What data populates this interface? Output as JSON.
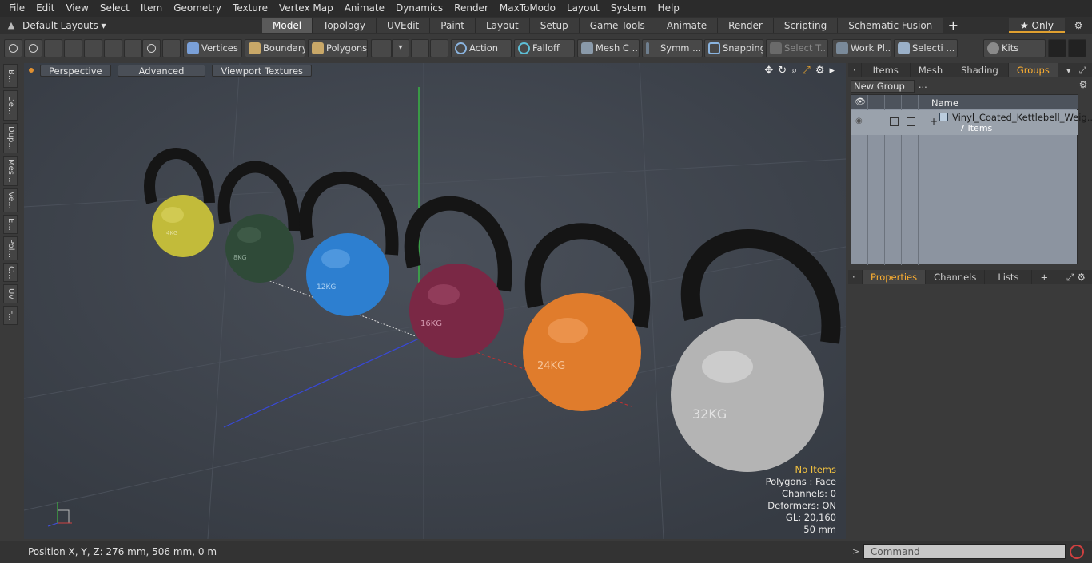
{
  "menu": [
    "File",
    "Edit",
    "View",
    "Select",
    "Item",
    "Geometry",
    "Texture",
    "Vertex Map",
    "Animate",
    "Dynamics",
    "Render",
    "MaxToModo",
    "Layout",
    "System",
    "Help"
  ],
  "layout": {
    "current": "Default Layouts ▾",
    "tabs": [
      "Model",
      "Topology",
      "UVEdit",
      "Paint",
      "Layout",
      "Setup",
      "Game Tools",
      "Animate",
      "Render",
      "Scripting",
      "Schematic Fusion"
    ],
    "active_tab": "Model",
    "only_label": "★ Only"
  },
  "toolbar": {
    "vertices": "Vertices",
    "boundary": "Boundary",
    "polygons": "Polygons",
    "action": "Action",
    "falloff": "Falloff",
    "mesh": "Mesh C ...",
    "symm": "Symm ...",
    "snapping": "Snapping",
    "select_t": "Select T...",
    "workpl": "Work Pl...",
    "selecti": "Selecti ...",
    "kits": "Kits"
  },
  "left_tabs": [
    "B...",
    "De...",
    "Dup...",
    "Mes...",
    "Ve...",
    "E...",
    "Pol...",
    "C...",
    "UV",
    "F..."
  ],
  "viewport": {
    "perspective": "Perspective",
    "advanced": "Advanced",
    "textures": "Viewport Textures",
    "info": {
      "no_items": "No Items",
      "polygons": "Polygons : Face",
      "channels": "Channels: 0",
      "deformers": "Deformers: ON",
      "gl": "GL: 20,160",
      "scale": "50 mm"
    },
    "kettlebell_labels": [
      "4KG",
      "8KG",
      "12KG",
      "16KG",
      "24KG",
      "32KG"
    ]
  },
  "right_panel": {
    "tabs": [
      "Items",
      "Mesh ...",
      "Shading",
      "Groups"
    ],
    "active_tab": "Groups",
    "new_group": "New Group",
    "column_name": "Name",
    "group_title": "Vinyl_Coated_Kettlebell_Weig...",
    "group_sub": "7 Items",
    "bottom_tabs": [
      "Properties",
      "Channels",
      "Lists"
    ],
    "bottom_active": "Properties"
  },
  "status": {
    "position": "Position X, Y, Z:   276 mm, 506 mm, 0 m",
    "command_placeholder": "Command"
  }
}
